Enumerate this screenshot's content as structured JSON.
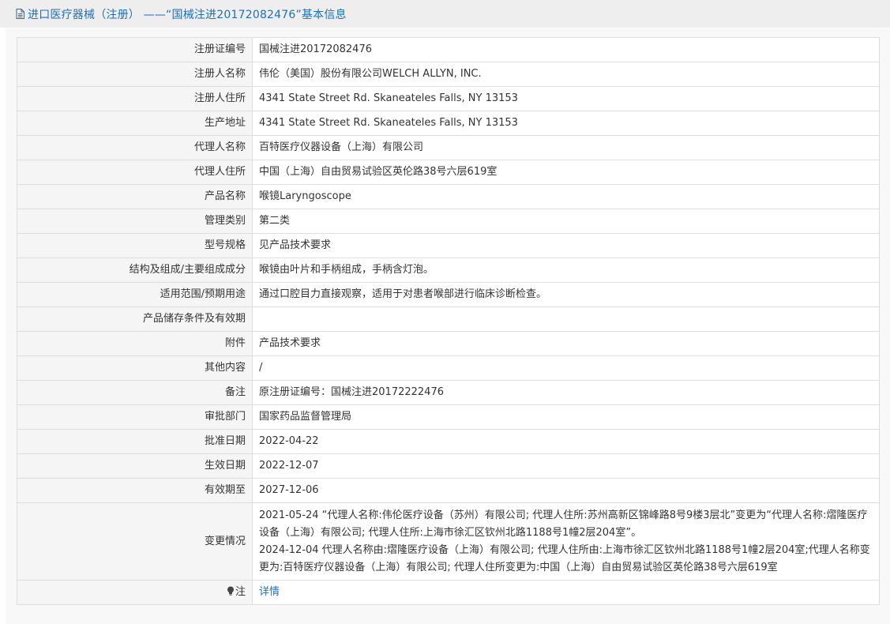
{
  "header": {
    "title": "进口医疗器械（注册） ——“国械注进20172082476”基本信息"
  },
  "rows": [
    {
      "label": "注册证编号",
      "value": "国械注进20172082476"
    },
    {
      "label": "注册人名称",
      "value": "伟伦（美国）股份有限公司WELCH ALLYN, INC."
    },
    {
      "label": "注册人住所",
      "value": "4341 State Street Rd. Skaneateles Falls, NY 13153"
    },
    {
      "label": "生产地址",
      "value": "4341 State Street Rd. Skaneateles Falls, NY 13153"
    },
    {
      "label": "代理人名称",
      "value": "百特医疗仪器设备（上海）有限公司"
    },
    {
      "label": "代理人住所",
      "value": "中国（上海）自由贸易试验区英伦路38号六层619室"
    },
    {
      "label": "产品名称",
      "value": "喉镜Laryngoscope"
    },
    {
      "label": "管理类别",
      "value": "第二类"
    },
    {
      "label": "型号规格",
      "value": "见产品技术要求"
    },
    {
      "label": "结构及组成/主要组成成分",
      "value": "喉镜由叶片和手柄组成，手柄含灯泡。"
    },
    {
      "label": "适用范围/预期用途",
      "value": "通过口腔目力直接观察，适用于对患者喉部进行临床诊断检查。"
    },
    {
      "label": "产品储存条件及有效期",
      "value": ""
    },
    {
      "label": "附件",
      "value": "产品技术要求"
    },
    {
      "label": "其他内容",
      "value": "/"
    },
    {
      "label": "备注",
      "value": "原注册证编号：国械注进20172222476"
    },
    {
      "label": "审批部门",
      "value": "国家药品监督管理局"
    },
    {
      "label": "批准日期",
      "value": "2022-04-22"
    },
    {
      "label": "生效日期",
      "value": "2022-12-07"
    },
    {
      "label": "有效期至",
      "value": "2027-12-06"
    }
  ],
  "change_history": {
    "label": "变更情况",
    "entries": [
      "2021-05-24 “代理人名称:伟伦医疗设备（苏州）有限公司; 代理人住所:苏州高新区锦峰路8号9楼3层北”变更为“代理人名称:熠隆医疗设备（上海）有限公司; 代理人住所:上海市徐汇区钦州北路1188号1幢2层204室”。",
      "2024-12-04 代理人名称由:熠隆医疗设备（上海）有限公司; 代理人住所由:上海市徐汇区钦州北路1188号1幢2层204室;代理人名称变更为:百特医疗仪器设备（上海）有限公司; 代理人住所变更为:中国（上海）自由贸易试验区英伦路38号六层619室"
    ]
  },
  "note_row": {
    "label": "注",
    "link": "详情",
    "icon": "lightbulb-icon"
  },
  "colors": {
    "link": "#1f6fb5",
    "header_bg": "#eeeeee",
    "label_bg": "#f5f5f5",
    "border": "#dedede"
  }
}
